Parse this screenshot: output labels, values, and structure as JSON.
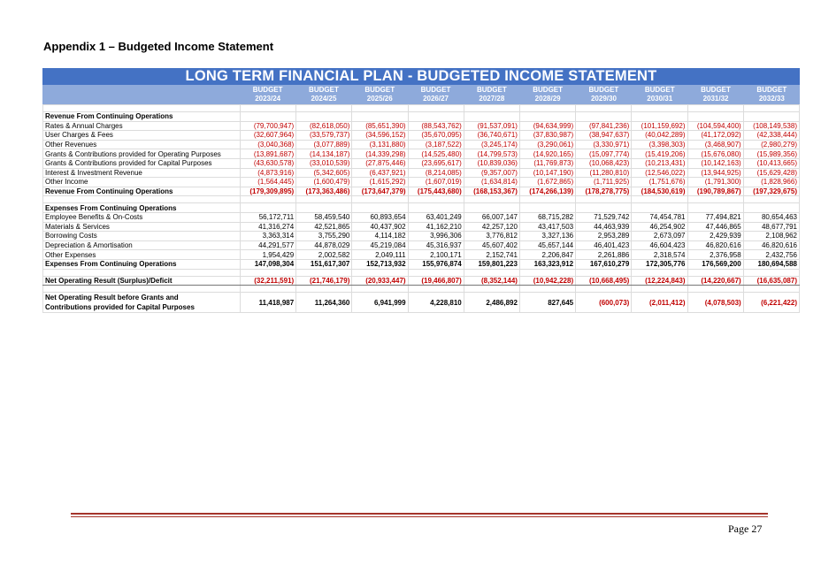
{
  "document": {
    "title": "Appendix 1 – Budgeted Income Statement",
    "page_label": "Page 27"
  },
  "table": {
    "banner": "LONG TERM FINANCIAL PLAN - BUDGETED INCOME STATEMENT",
    "columns": [
      {
        "top": "BUDGET",
        "year": "2023/24"
      },
      {
        "top": "BUDGET",
        "year": "2024/25"
      },
      {
        "top": "BUDGET",
        "year": "2025/26"
      },
      {
        "top": "BUDGET",
        "year": "2026/27"
      },
      {
        "top": "BUDGET",
        "year": "2027/28"
      },
      {
        "top": "BUDGET",
        "year": "2028/29"
      },
      {
        "top": "BUDGET",
        "year": "2029/30"
      },
      {
        "top": "BUDGET",
        "year": "2030/31"
      },
      {
        "top": "BUDGET",
        "year": "2031/32"
      },
      {
        "top": "BUDGET",
        "year": "2032/33"
      }
    ],
    "rows": [
      {
        "kind": "spacer",
        "label": "",
        "values": []
      },
      {
        "kind": "section",
        "label": "Revenue From Continuing Operations",
        "values": []
      },
      {
        "kind": "line",
        "label": "Rates & Annual Charges",
        "values": [
          "(79,700,947)",
          "(82,618,050)",
          "(85,651,390)",
          "(88,543,762)",
          "(91,537,091)",
          "(94,634,999)",
          "(97,841,236)",
          "(101,159,692)",
          "(104,594,400)",
          "(108,149,538)"
        ]
      },
      {
        "kind": "line",
        "label": "User Charges & Fees",
        "values": [
          "(32,607,964)",
          "(33,579,737)",
          "(34,596,152)",
          "(35,670,095)",
          "(36,740,671)",
          "(37,830,987)",
          "(38,947,637)",
          "(40,042,289)",
          "(41,172,092)",
          "(42,338,444)"
        ]
      },
      {
        "kind": "line",
        "label": "Other Revenues",
        "values": [
          "(3,040,368)",
          "(3,077,889)",
          "(3,131,880)",
          "(3,187,522)",
          "(3,245,174)",
          "(3,290,061)",
          "(3,330,971)",
          "(3,398,303)",
          "(3,468,907)",
          "(2,980,279)"
        ]
      },
      {
        "kind": "line",
        "label": "Grants & Contributions provided for Operating Purposes",
        "values": [
          "(13,891,687)",
          "(14,134,187)",
          "(14,339,298)",
          "(14,525,480)",
          "(14,799,573)",
          "(14,920,165)",
          "(15,097,774)",
          "(15,419,206)",
          "(15,676,080)",
          "(15,989,356)"
        ]
      },
      {
        "kind": "line",
        "label": "Grants & Contributions provided for Capital Purposes",
        "values": [
          "(43,630,578)",
          "(33,010,539)",
          "(27,875,446)",
          "(23,695,617)",
          "(10,839,036)",
          "(11,769,873)",
          "(10,068,423)",
          "(10,213,431)",
          "(10,142,163)",
          "(10,413,665)"
        ]
      },
      {
        "kind": "line",
        "label": "Interest & Investment Revenue",
        "values": [
          "(4,873,916)",
          "(5,342,605)",
          "(6,437,921)",
          "(8,214,085)",
          "(9,357,007)",
          "(10,147,190)",
          "(11,280,810)",
          "(12,546,022)",
          "(13,944,925)",
          "(15,629,428)"
        ]
      },
      {
        "kind": "line",
        "label": "Other Income",
        "values": [
          "(1,564,445)",
          "(1,600,479)",
          "(1,615,292)",
          "(1,607,019)",
          "(1,634,814)",
          "(1,672,865)",
          "(1,711,925)",
          "(1,751,676)",
          "(1,791,300)",
          "(1,828,966)"
        ]
      },
      {
        "kind": "total",
        "label": "Revenue From Continuing Operations",
        "values": [
          "(179,309,895)",
          "(173,363,486)",
          "(173,647,379)",
          "(175,443,680)",
          "(168,153,367)",
          "(174,266,139)",
          "(178,278,775)",
          "(184,530,619)",
          "(190,789,867)",
          "(197,329,675)"
        ]
      },
      {
        "kind": "spacer",
        "label": "",
        "values": []
      },
      {
        "kind": "section",
        "label": "Expenses From Continuing Operations",
        "values": []
      },
      {
        "kind": "line",
        "label": "Employee Benefits & On-Costs",
        "values": [
          "56,172,711",
          "58,459,540",
          "60,893,654",
          "63,401,249",
          "66,007,147",
          "68,715,282",
          "71,529,742",
          "74,454,781",
          "77,494,821",
          "80,654,463"
        ]
      },
      {
        "kind": "line",
        "label": "Materials & Services",
        "values": [
          "41,316,274",
          "42,521,865",
          "40,437,902",
          "41,162,210",
          "42,257,120",
          "43,417,503",
          "44,463,939",
          "46,254,902",
          "47,446,865",
          "48,677,791"
        ]
      },
      {
        "kind": "line",
        "label": "Borrowing Costs",
        "values": [
          "3,363,314",
          "3,755,290",
          "4,114,182",
          "3,996,306",
          "3,776,812",
          "3,327,136",
          "2,953,289",
          "2,673,097",
          "2,429,939",
          "2,108,962"
        ]
      },
      {
        "kind": "line",
        "label": "Depreciation & Amortisation",
        "values": [
          "44,291,577",
          "44,878,029",
          "45,219,084",
          "45,316,937",
          "45,607,402",
          "45,657,144",
          "46,401,423",
          "46,604,423",
          "46,820,616",
          "46,820,616"
        ]
      },
      {
        "kind": "line",
        "label": "Other Expenses",
        "values": [
          "1,954,429",
          "2,002,582",
          "2,049,111",
          "2,100,171",
          "2,152,741",
          "2,206,847",
          "2,261,886",
          "2,318,574",
          "2,376,958",
          "2,432,756"
        ]
      },
      {
        "kind": "total",
        "label": "Expenses From Continuing Operations",
        "values": [
          "147,098,304",
          "151,617,307",
          "152,713,932",
          "155,976,874",
          "159,801,223",
          "163,323,912",
          "167,610,279",
          "172,305,776",
          "176,569,200",
          "180,694,588"
        ]
      },
      {
        "kind": "spacer",
        "label": "",
        "values": []
      },
      {
        "kind": "net",
        "label": "Net Operating Result (Surplus)/Deficit",
        "values": [
          "(32,211,591)",
          "(21,746,179)",
          "(20,933,447)",
          "(19,466,807)",
          "(8,352,144)",
          "(10,942,228)",
          "(10,668,495)",
          "(12,224,843)",
          "(14,220,667)",
          "(16,635,087)"
        ]
      },
      {
        "kind": "spacer",
        "label": "",
        "values": []
      },
      {
        "kind": "net2",
        "label": "Net Operating Result before Grants and",
        "label2": "Contributions provided for Capital Purposes",
        "values": [
          "11,418,987",
          "11,264,360",
          "6,941,999",
          "4,228,810",
          "2,486,892",
          "827,645",
          "(600,073)",
          "(2,011,412)",
          "(4,078,503)",
          "(6,221,422)"
        ]
      }
    ],
    "negative_color": "#c00000"
  }
}
